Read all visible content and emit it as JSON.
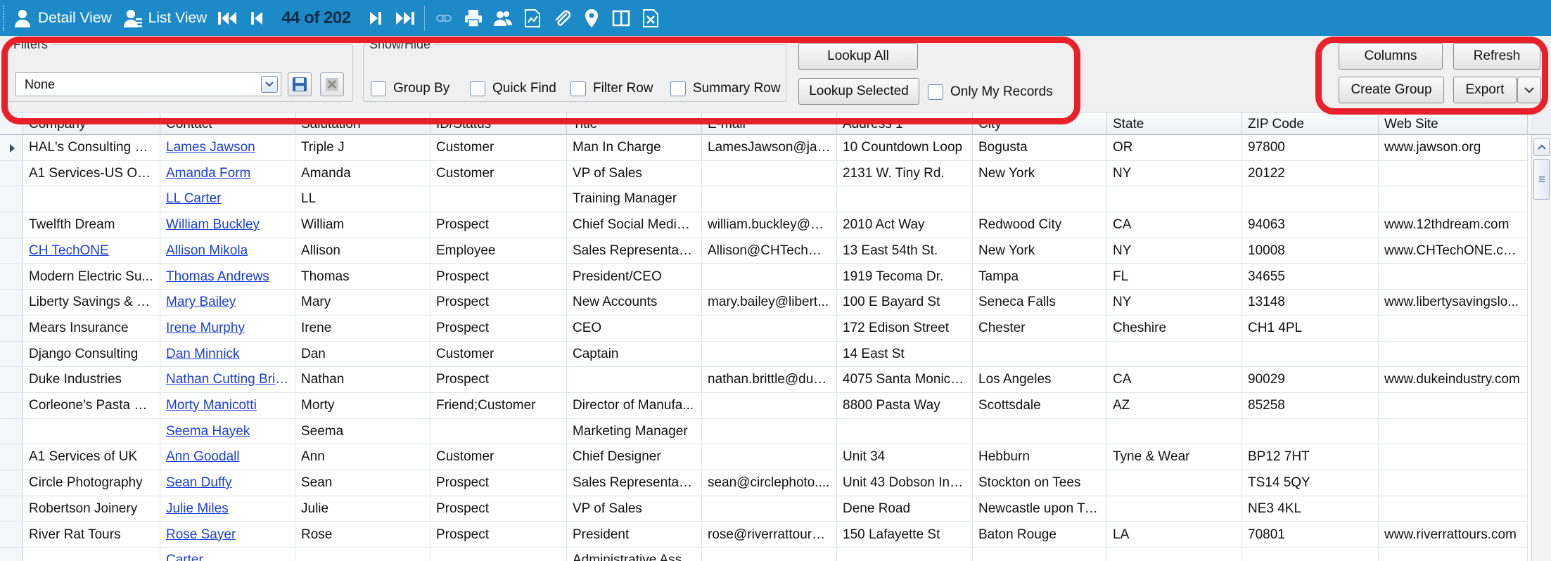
{
  "toolbar": {
    "detail_view": "Detail View",
    "list_view": "List View",
    "record_position": "44 of 202"
  },
  "filters": {
    "legend": "Filters",
    "selected": "None"
  },
  "show_hide": {
    "legend": "Show/Hide",
    "group_by": "Group By",
    "quick_find": "Quick Find",
    "filter_row": "Filter Row",
    "summary_row": "Summary Row"
  },
  "lookup": {
    "all": "Lookup All",
    "selected": "Lookup Selected",
    "only_mine": "Only My Records"
  },
  "actions": {
    "columns": "Columns",
    "refresh": "Refresh",
    "create_group": "Create Group",
    "export": "Export"
  },
  "grid": {
    "columns": [
      "Company",
      "Contact",
      "Salutation",
      "ID/Status",
      "Title",
      "E-mail",
      "Address 1",
      "City",
      "State",
      "ZIP Code",
      "Web Site"
    ],
    "rows": [
      [
        "HAL's Consulting C...",
        "Lames Jawson",
        "Triple J",
        "Customer",
        "Man In Charge",
        "LamesJawson@jaw...",
        "10 Countdown Loop",
        "Bogusta",
        "OR",
        "97800",
        "www.jawson.org"
      ],
      [
        "A1 Services-US Op...",
        "Amanda Form",
        "Amanda",
        "Customer",
        "VP of Sales",
        "",
        "2131 W. Tiny Rd.",
        "New York",
        "NY",
        "20122",
        ""
      ],
      [
        "",
        "LL Carter",
        "LL",
        "",
        "Training Manager",
        "",
        "",
        "",
        "",
        "",
        ""
      ],
      [
        "Twelfth Dream",
        "William Buckley",
        "William",
        "Prospect",
        "Chief Social Media ...",
        "william.buckley@12...",
        "2010 Act Way",
        "Redwood City",
        "CA",
        "94063",
        "www.12thdream.com"
      ],
      [
        "CH TechONE",
        "Allison Mikola",
        "Allison",
        "Employee",
        "Sales Representative",
        "Allison@CHTechON...",
        "13 East 54th St.",
        "New York",
        "NY",
        "10008",
        "www.CHTechONE.com"
      ],
      [
        "Modern Electric Su...",
        "Thomas Andrews",
        "Thomas",
        "Prospect",
        "President/CEO",
        "",
        "1919 Tecoma Dr.",
        "Tampa",
        "FL",
        "34655",
        ""
      ],
      [
        "Liberty Savings & L...",
        "Mary Bailey",
        "Mary",
        "Prospect",
        "New Accounts",
        "mary.bailey@libert...",
        "100 E Bayard St",
        "Seneca Falls",
        "NY",
        "13148",
        "www.libertysavingslo..."
      ],
      [
        "Mears Insurance",
        "Irene Murphy",
        "Irene",
        "Prospect",
        "CEO",
        "",
        "172 Edison Street",
        "Chester",
        "Cheshire",
        "CH1 4PL",
        ""
      ],
      [
        "Django Consulting",
        "Dan Minnick",
        "Dan",
        "Customer",
        "Captain",
        "",
        "14 East St",
        "",
        "",
        "",
        ""
      ],
      [
        "Duke Industries",
        "Nathan Cutting Brit...",
        "Nathan",
        "Prospect",
        "",
        "nathan.brittle@duk...",
        "4075 Santa Monica...",
        "Los Angeles",
        "CA",
        "90029",
        "www.dukeindustry.com"
      ],
      [
        "Corleone's Pasta C...",
        "Morty Manicotti",
        "Morty",
        "Friend;Customer",
        "Director of Manufa...",
        "",
        "8800 Pasta Way",
        "Scottsdale",
        "AZ",
        "85258",
        ""
      ],
      [
        "",
        "Seema Hayek",
        "Seema",
        "",
        "Marketing Manager",
        "",
        "",
        "",
        "",
        "",
        ""
      ],
      [
        "A1 Services of UK",
        "Ann Goodall",
        "Ann",
        "Customer",
        "Chief Designer",
        "",
        "Unit 34",
        "Hebburn",
        "Tyne & Wear",
        "BP12 7HT",
        ""
      ],
      [
        "Circle Photography",
        "Sean Duffy",
        "Sean",
        "Prospect",
        "Sales Representative",
        "sean@circlephoto....",
        "Unit 43 Dobson Ind...",
        "Stockton on Tees",
        "",
        "TS14 5QY",
        ""
      ],
      [
        "Robertson Joinery",
        "Julie Miles",
        "Julie",
        "Prospect",
        "VP of Sales",
        "",
        "Dene Road",
        "Newcastle upon Ty...",
        "",
        "NE3 4KL",
        ""
      ],
      [
        "River Rat Tours",
        "Rose Sayer",
        "Rose",
        "Prospect",
        "President",
        "rose@riverrattours....",
        "150 Lafayette St",
        "Baton Rouge",
        "LA",
        "70801",
        "www.riverrattours.com"
      ],
      [
        "",
        "Carter",
        "",
        "",
        "Administrative Assi...",
        "",
        "",
        "",
        "",
        "",
        ""
      ]
    ],
    "current_row": 0,
    "linked_company_rows": [
      4
    ]
  },
  "colors": {
    "toolbar_bg": "#1d8ac8",
    "highlight": "#e8202a",
    "link": "#1a3fd6"
  }
}
